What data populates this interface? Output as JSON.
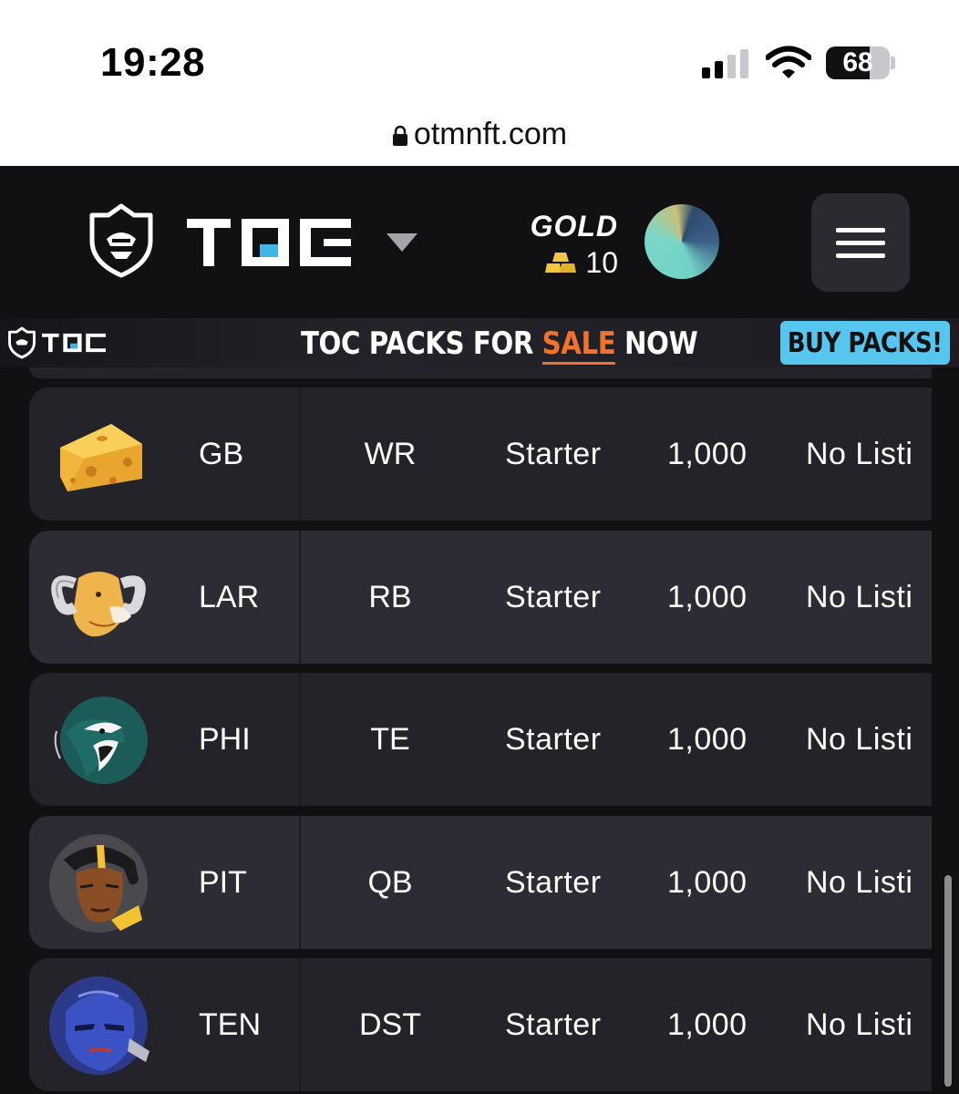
{
  "status_bar": {
    "time": "19:28",
    "battery": "68",
    "battery_level": 0.68
  },
  "browser": {
    "url": "otmnft.com"
  },
  "header": {
    "brand": "TOC",
    "currency_label": "GOLD",
    "currency_amount": "10"
  },
  "promo": {
    "text_before": "TOC PACKS FOR ",
    "text_highlight": "SALE",
    "text_after": " NOW",
    "button_label": "BUY PACKS!",
    "highlight_color": "#f0722c",
    "button_color": "#56c6ee"
  },
  "rows": [
    {
      "team": "GB",
      "position": "WR",
      "tier": "Starter",
      "supply": "1,000",
      "listing": "No Listi",
      "logo": "cheese-icon"
    },
    {
      "team": "LAR",
      "position": "RB",
      "tier": "Starter",
      "supply": "1,000",
      "listing": "No Listi",
      "logo": "ram-icon"
    },
    {
      "team": "PHI",
      "position": "TE",
      "tier": "Starter",
      "supply": "1,000",
      "listing": "No Listi",
      "logo": "eagle-icon"
    },
    {
      "team": "PIT",
      "position": "QB",
      "tier": "Starter",
      "supply": "1,000",
      "listing": "No Listi",
      "logo": "steeler-player-icon"
    },
    {
      "team": "TEN",
      "position": "DST",
      "tier": "Starter",
      "supply": "1,000",
      "listing": "No Listi",
      "logo": "titan-icon"
    }
  ]
}
